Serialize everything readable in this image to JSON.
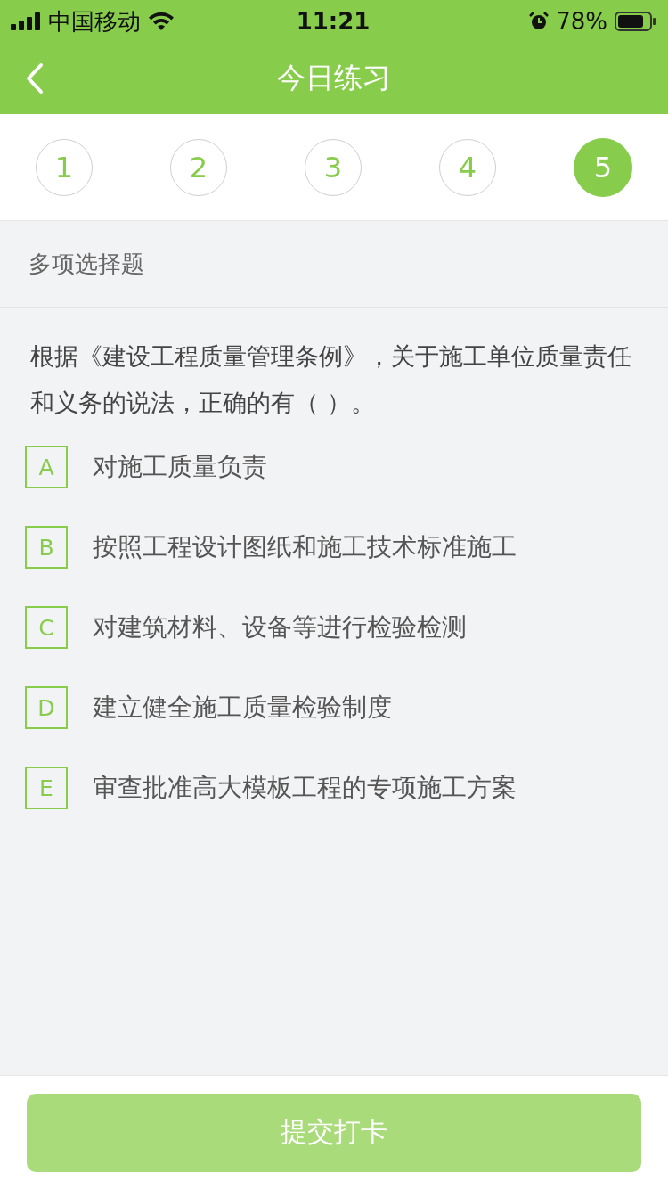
{
  "status_bar": {
    "carrier": "中国移动",
    "time": "11:21",
    "battery": "78%"
  },
  "nav": {
    "title": "今日练习"
  },
  "question_tabs": [
    {
      "label": "1",
      "selected": false
    },
    {
      "label": "2",
      "selected": false
    },
    {
      "label": "3",
      "selected": false
    },
    {
      "label": "4",
      "selected": false
    },
    {
      "label": "5",
      "selected": true
    }
  ],
  "question_type": "多项选择题",
  "question": "根据《建设工程质量管理条例》，关于施工单位质量责任和义务的说法，正确的有（    ）。",
  "options": [
    {
      "letter": "A",
      "text": "对施工质量负责",
      "selected": false
    },
    {
      "letter": "B",
      "text": "按照工程设计图纸和施工技术标准施工",
      "selected": false
    },
    {
      "letter": "C",
      "text": "对建筑材料、设备等进行检验检测",
      "selected": false
    },
    {
      "letter": "D",
      "text": "建立健全施工质量检验制度",
      "selected": false
    },
    {
      "letter": "E",
      "text": "审查批准高大模板工程的专项施工方案",
      "selected": false
    }
  ],
  "submit_button": {
    "label": "提交打卡",
    "disabled": true
  }
}
